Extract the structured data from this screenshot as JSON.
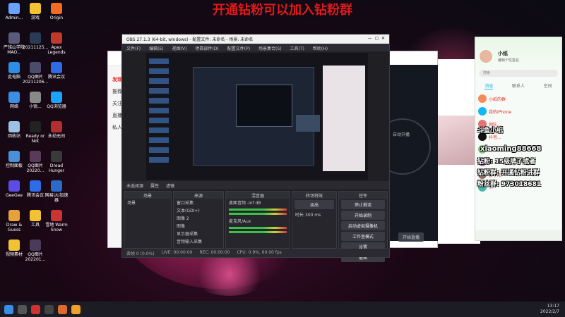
{
  "banner": "开通钻粉可以加入钻粉群",
  "desktop_icons": [
    {
      "label": "Admin...",
      "color": "#6aa3ff"
    },
    {
      "label": "游戏",
      "color": "#f1c232"
    },
    {
      "label": "Origin",
      "color": "#f26b21"
    },
    {
      "label": "严铭山学院MAO...",
      "color": "#5a5a7a"
    },
    {
      "label": "20211125...",
      "color": "#2b3a55"
    },
    {
      "label": "Apex Legends",
      "color": "#c0392b"
    },
    {
      "label": "此电脑",
      "color": "#2e8de6"
    },
    {
      "label": "QQ图片20211206...",
      "color": "#4b4b6b"
    },
    {
      "label": "腾讯会议",
      "color": "#2e6be6"
    },
    {
      "label": "网络",
      "color": "#3a8ee6"
    },
    {
      "label": "小锐...",
      "color": "#888"
    },
    {
      "label": "QQ浏览器",
      "color": "#1aa3ff"
    },
    {
      "label": "回收站",
      "color": "#9cc3e6"
    },
    {
      "label": "Ready or Not",
      "color": "#222"
    },
    {
      "label": "永劫无间",
      "color": "#b32e2e"
    },
    {
      "label": "控制面板",
      "color": "#4a90d9"
    },
    {
      "label": "QQ图片20220...",
      "color": "#5a3a5a"
    },
    {
      "label": "Dread Hunger",
      "color": "#3a3a3a"
    },
    {
      "label": "GeeGee",
      "color": "#5b4ce6"
    },
    {
      "label": "腾讯会议",
      "color": "#2e6be6"
    },
    {
      "label": "网易UU加速器",
      "color": "#2a6acb"
    },
    {
      "label": "Draw & Guess",
      "color": "#e6a13a"
    },
    {
      "label": "工具",
      "color": "#f1c232"
    },
    {
      "label": "雪地 Warm Snow",
      "color": "#c33"
    },
    {
      "label": "视频素材",
      "color": "#f1c232"
    },
    {
      "label": "QQ图片202201...",
      "color": "#4b3b5b"
    }
  ],
  "obs": {
    "title": "OBS 27.1.3 (64-bit, windows) - 配置文件: 未命名 - 场景: 未命名",
    "menu": [
      "文件(F)",
      "编辑(E)",
      "视图(V)",
      "停靠部件(D)",
      "配置文件(P)",
      "场景集合(S)",
      "工具(T)",
      "帮助(H)"
    ],
    "bar_items": [
      "未选择源",
      "属性",
      "滤镜"
    ],
    "docks": {
      "scenes": {
        "header": "场景",
        "items": [
          "场景"
        ]
      },
      "sources": {
        "header": "来源",
        "items": [
          "窗口采集",
          "文本(GDI+)",
          "图像 2",
          "图像",
          "显示器采集",
          "音频输入采集"
        ]
      },
      "mixer": {
        "header": "混音器",
        "items": [
          "桌面音频 -inf dB",
          "麦克风/Aux"
        ]
      },
      "transitions": {
        "header": "转场特效",
        "mode": "淡出",
        "duration_label": "时长",
        "duration": "300 ms"
      },
      "controls": {
        "header": "控件",
        "buttons": [
          "停止推流",
          "开始录制",
          "启动虚拟摄像机",
          "工作室模式",
          "设置",
          "退出"
        ]
      }
    },
    "status": [
      "丢帧 0 (0.0%)",
      "LIVE: 00:00:00",
      "REC: 00:00:00",
      "CPU: 0.9%, 60.00 fps"
    ]
  },
  "live_button": "开始直播",
  "auto_open": "自动开播",
  "qq": {
    "name": "小纸",
    "status": "编辑个性签名",
    "search_placeholder": "搜索",
    "tabs": [
      "消息",
      "联系人",
      "空间"
    ],
    "items": [
      {
        "title": "小纸的群",
        "preview": "...",
        "color": "#f38b5c"
      },
      {
        "title": "我的iPhone",
        "preview": "",
        "color": "#12b7f5"
      },
      {
        "title": "网队...",
        "preview": "...",
        "color": "#e57373"
      },
      {
        "title": "抖音...",
        "preview": "...",
        "color": "#111"
      },
      {
        "title": "群...",
        "preview": "...",
        "color": "#81c784"
      },
      {
        "title": "群...",
        "preview": "...",
        "color": "#ba68c8"
      },
      {
        "title": "游子阳",
        "preview": "",
        "color": "#8d6e63"
      },
      {
        "title": "...",
        "preview": "",
        "color": "#4db6ac"
      }
    ]
  },
  "overlays": [
    "斗鱼小纸",
    "xiaoming88668",
    "钻粉: 15级牌子或者",
    "钻粉群: 开通钻粉进群",
    "粉丝群: 973018681"
  ],
  "taskbar_time": "13:17",
  "taskbar_date": "2022/2/7"
}
